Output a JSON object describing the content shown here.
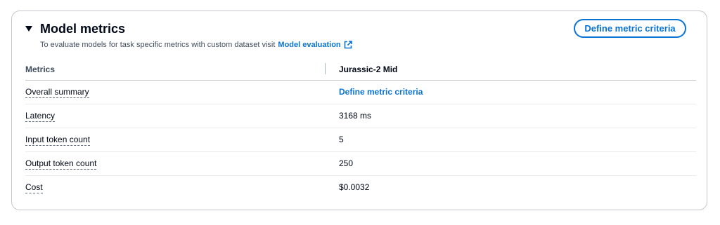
{
  "section": {
    "title": "Model metrics",
    "description": "To evaluate models for task specific metrics with custom dataset visit",
    "link_label": "Model evaluation",
    "define_button_label": "Define metric criteria"
  },
  "table": {
    "headers": {
      "metrics": "Metrics",
      "model": "Jurassic-2 Mid"
    },
    "rows": [
      {
        "metric": "Overall summary",
        "value": "Define metric criteria"
      },
      {
        "metric": "Latency",
        "value": "3168 ms"
      },
      {
        "metric": "Input token count",
        "value": "5"
      },
      {
        "metric": "Output token count",
        "value": "250"
      },
      {
        "metric": "Cost",
        "value": "$0.0032"
      }
    ]
  },
  "colors": {
    "link": "#0972d3",
    "text": "#000716",
    "border": "#c6c6cd"
  }
}
